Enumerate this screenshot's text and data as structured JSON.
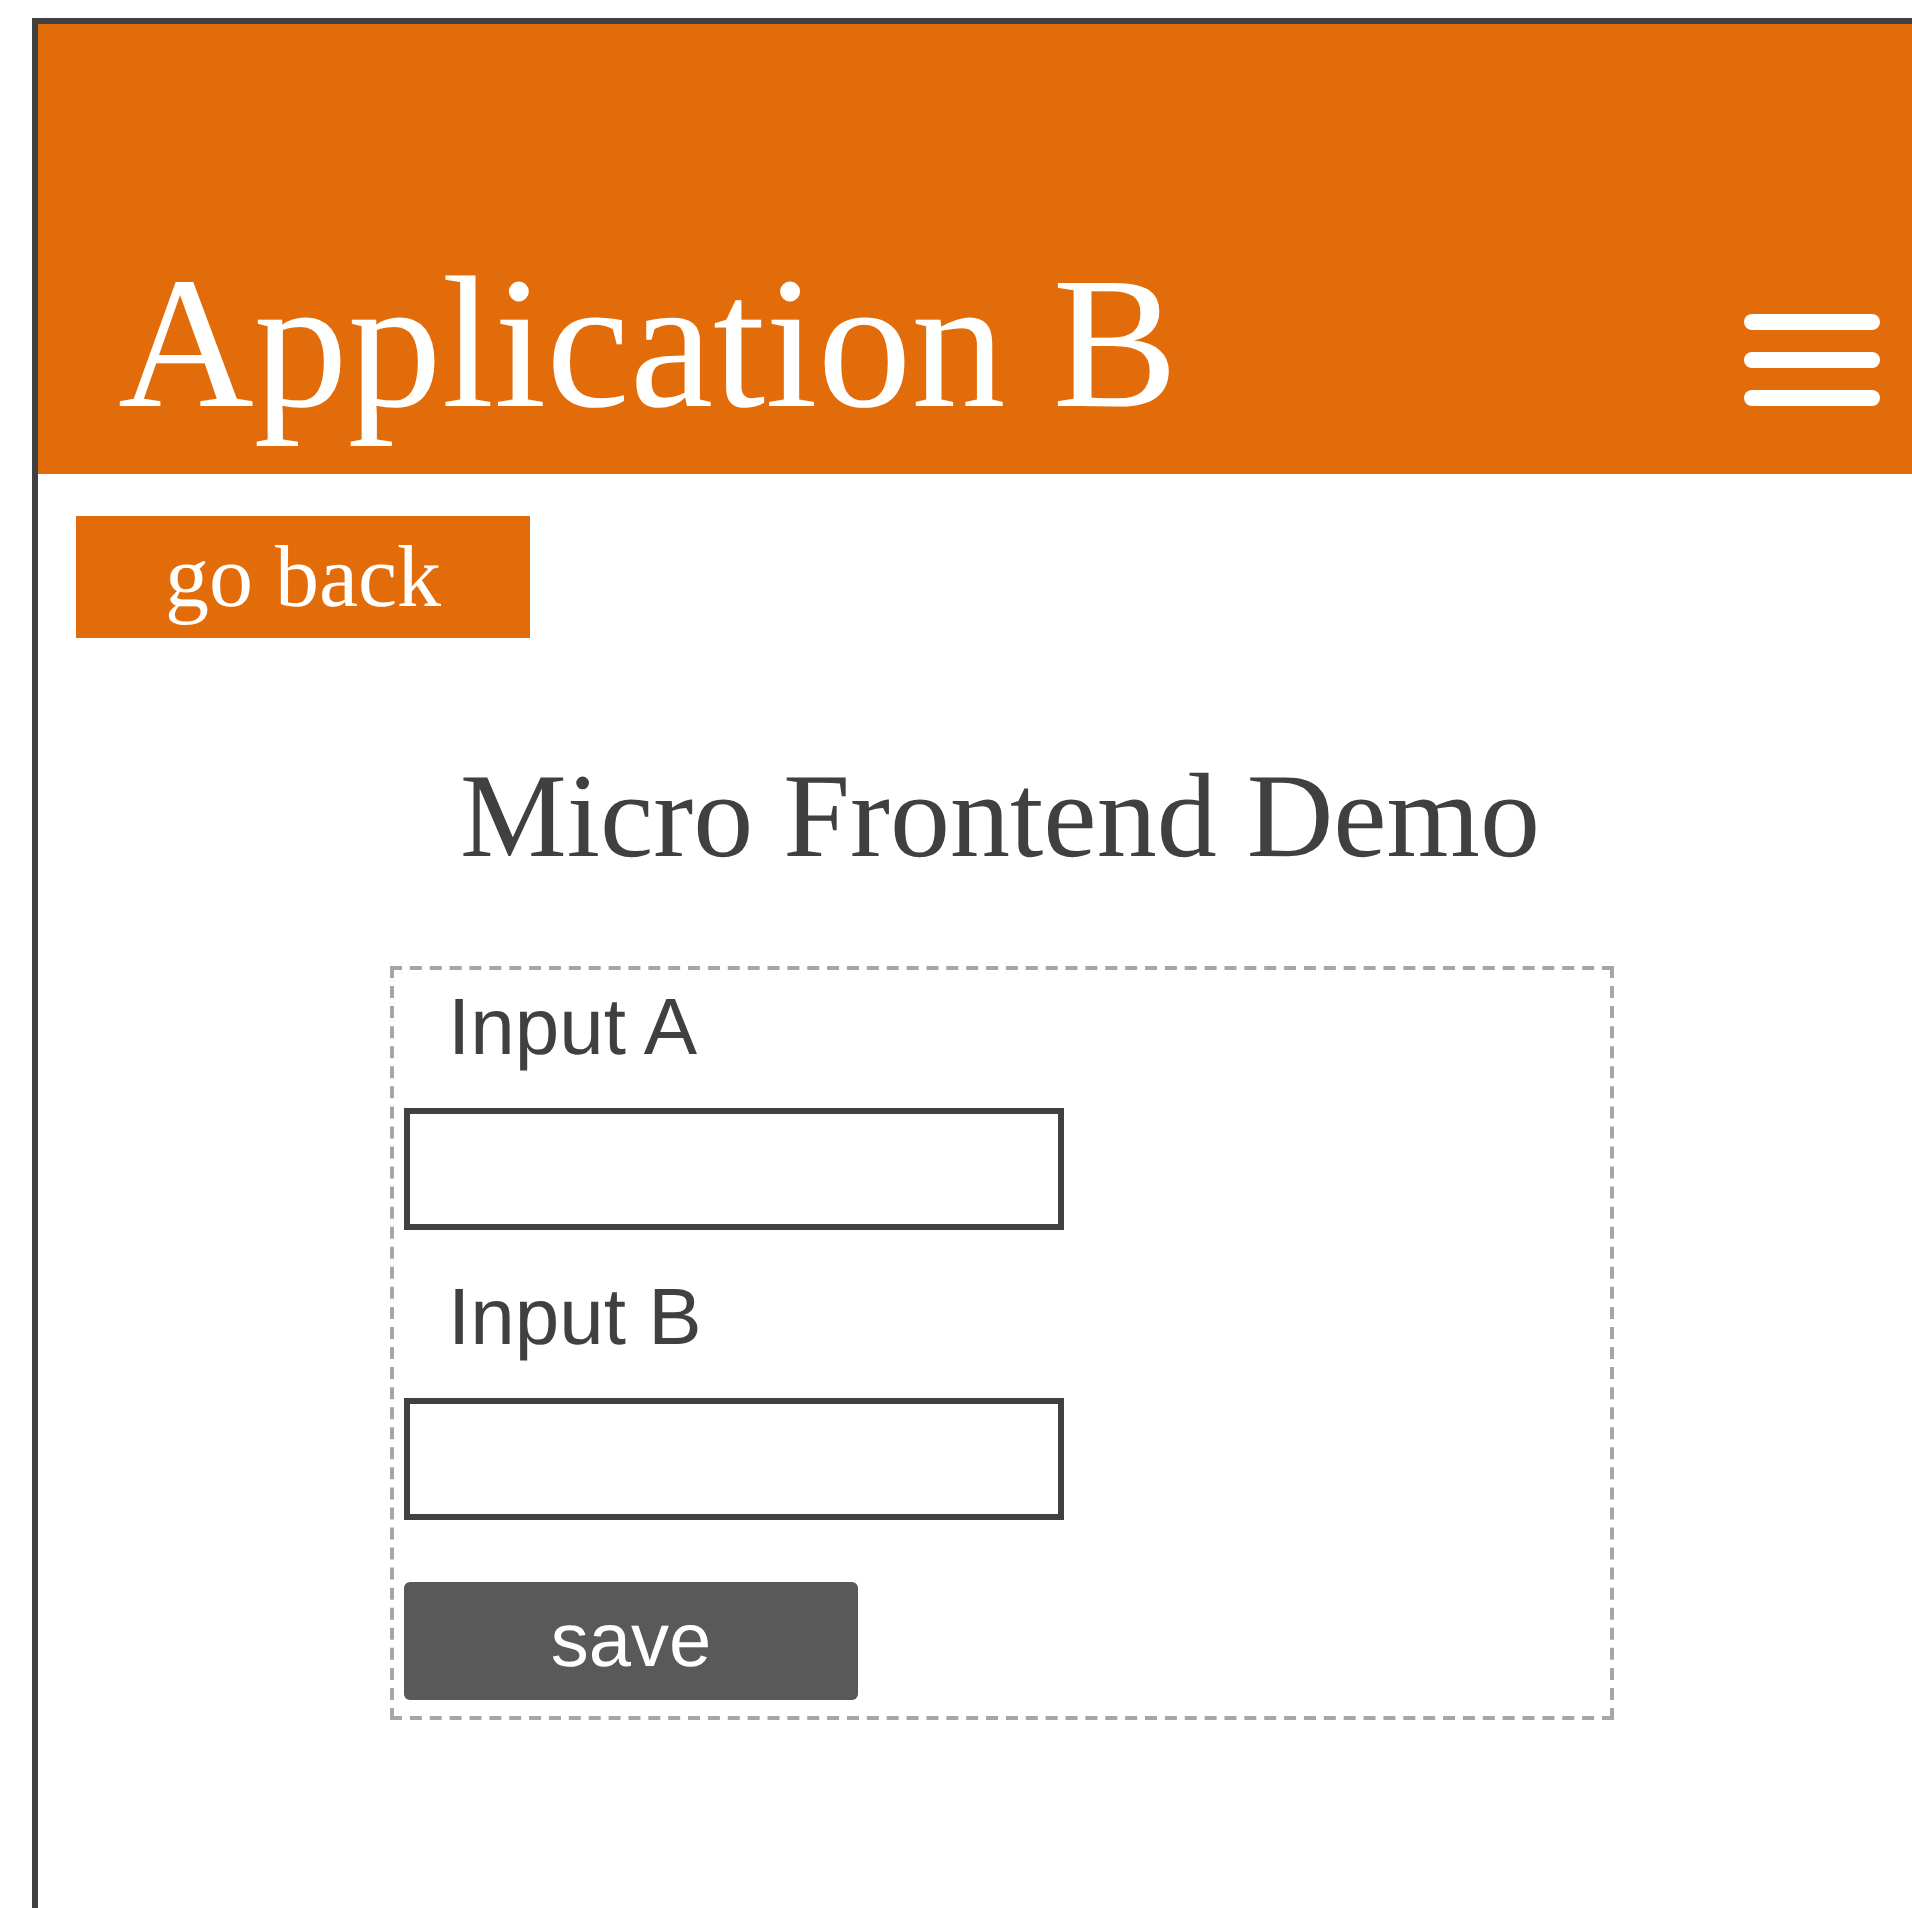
{
  "header": {
    "title": "Application B"
  },
  "back_button": {
    "label": "go back"
  },
  "heading": "Micro Frontend Demo",
  "form": {
    "fields": [
      {
        "label": "Input A"
      },
      {
        "label": "Input B"
      }
    ],
    "save_button": {
      "label": "save"
    }
  }
}
